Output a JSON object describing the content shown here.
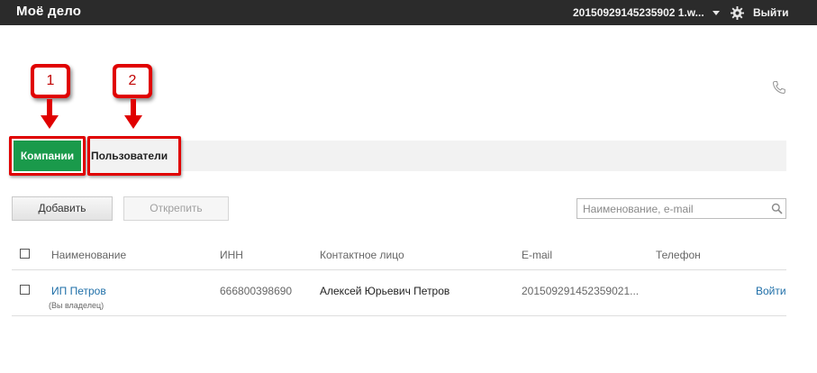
{
  "topbar": {
    "logo": "Моё дело",
    "account": "20150929145235902 1.w...",
    "logout": "Выйти"
  },
  "annotations": {
    "first": "1",
    "second": "2"
  },
  "tabs": [
    {
      "label": "Компании",
      "active": true
    },
    {
      "label": "Пользователи",
      "active": false
    }
  ],
  "toolbar": {
    "add_label": "Добавить",
    "detach_label": "Открепить",
    "search_placeholder": "Наименование, e-mail"
  },
  "table": {
    "headers": {
      "name": "Наименование",
      "inn": "ИНН",
      "contact": "Контактное лицо",
      "email": "E-mail",
      "phone": "Телефон"
    },
    "rows": [
      {
        "name": "ИП Петров",
        "role": "(Вы владелец)",
        "inn": "666800398690",
        "contact": "Алексей Юрьевич Петров",
        "email": "201509291452359021...",
        "action": "Войти"
      }
    ]
  },
  "colors": {
    "topbar": "#2b2b2b",
    "active_tab": "#1a9a4b",
    "annotation": "#e00000",
    "link": "#1f6fa8"
  }
}
